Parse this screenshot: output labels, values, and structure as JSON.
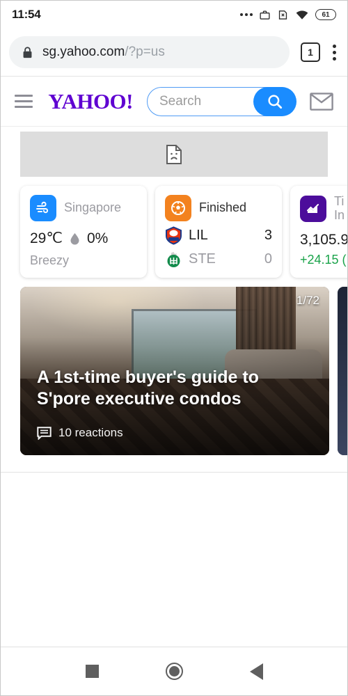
{
  "statusbar": {
    "time": "11:54",
    "battery_level": "61",
    "icons": [
      "overflow-dots-icon",
      "work-profile-briefcase-icon",
      "sim-disabled-icon",
      "wifi-icon",
      "battery-icon"
    ]
  },
  "browser": {
    "lock_icon": "lock-icon",
    "url_domain": "sg.yahoo.com",
    "url_path": "/?p=us",
    "tab_count": "1",
    "menu_icon": "kebab-menu-icon"
  },
  "yahoo_header": {
    "menu_icon": "hamburger-menu-icon",
    "logo_text": "YAHOO!",
    "logo_color": "#5f01d1",
    "search_placeholder": "Search",
    "search_value": "",
    "search_button_icon": "search-icon",
    "search_button_color": "#1a8cff",
    "mail_icon": "mail-envelope-icon"
  },
  "banner": {
    "state": "broken-image",
    "icon": "broken-image-icon"
  },
  "cards": [
    {
      "type": "weather",
      "icon": "wind-icon",
      "icon_color": "#1a8cff",
      "location": "Singapore",
      "temperature": "29℃",
      "precip_icon": "water-drop-icon",
      "precipitation": "0%",
      "condition": "Breezy"
    },
    {
      "type": "sports",
      "icon": "soccer-ball-icon",
      "icon_color": "#f3821f",
      "status": "Finished",
      "teams": [
        {
          "logo": "lille-crest-icon",
          "abbr": "LIL",
          "score": "3"
        },
        {
          "logo": "saint-etienne-crest-icon",
          "abbr": "STE",
          "score": "0"
        }
      ]
    },
    {
      "type": "finance",
      "icon": "trending-chart-icon",
      "icon_color": "#4c0d9b",
      "name_line1": "Ti",
      "name_line2": "In",
      "value": "3,105.9",
      "change": "+24.15 (",
      "change_color": "#1aa34a"
    }
  ],
  "article": {
    "counter": "1/72",
    "headline": "A 1st-time buyer's guide to S'pore executive condos",
    "reactions_icon": "comment-bubble-icon",
    "reactions": "10 reactions"
  },
  "navbar": {
    "recents_icon": "square-recents-icon",
    "home_icon": "circle-home-icon",
    "back_icon": "triangle-back-icon"
  }
}
